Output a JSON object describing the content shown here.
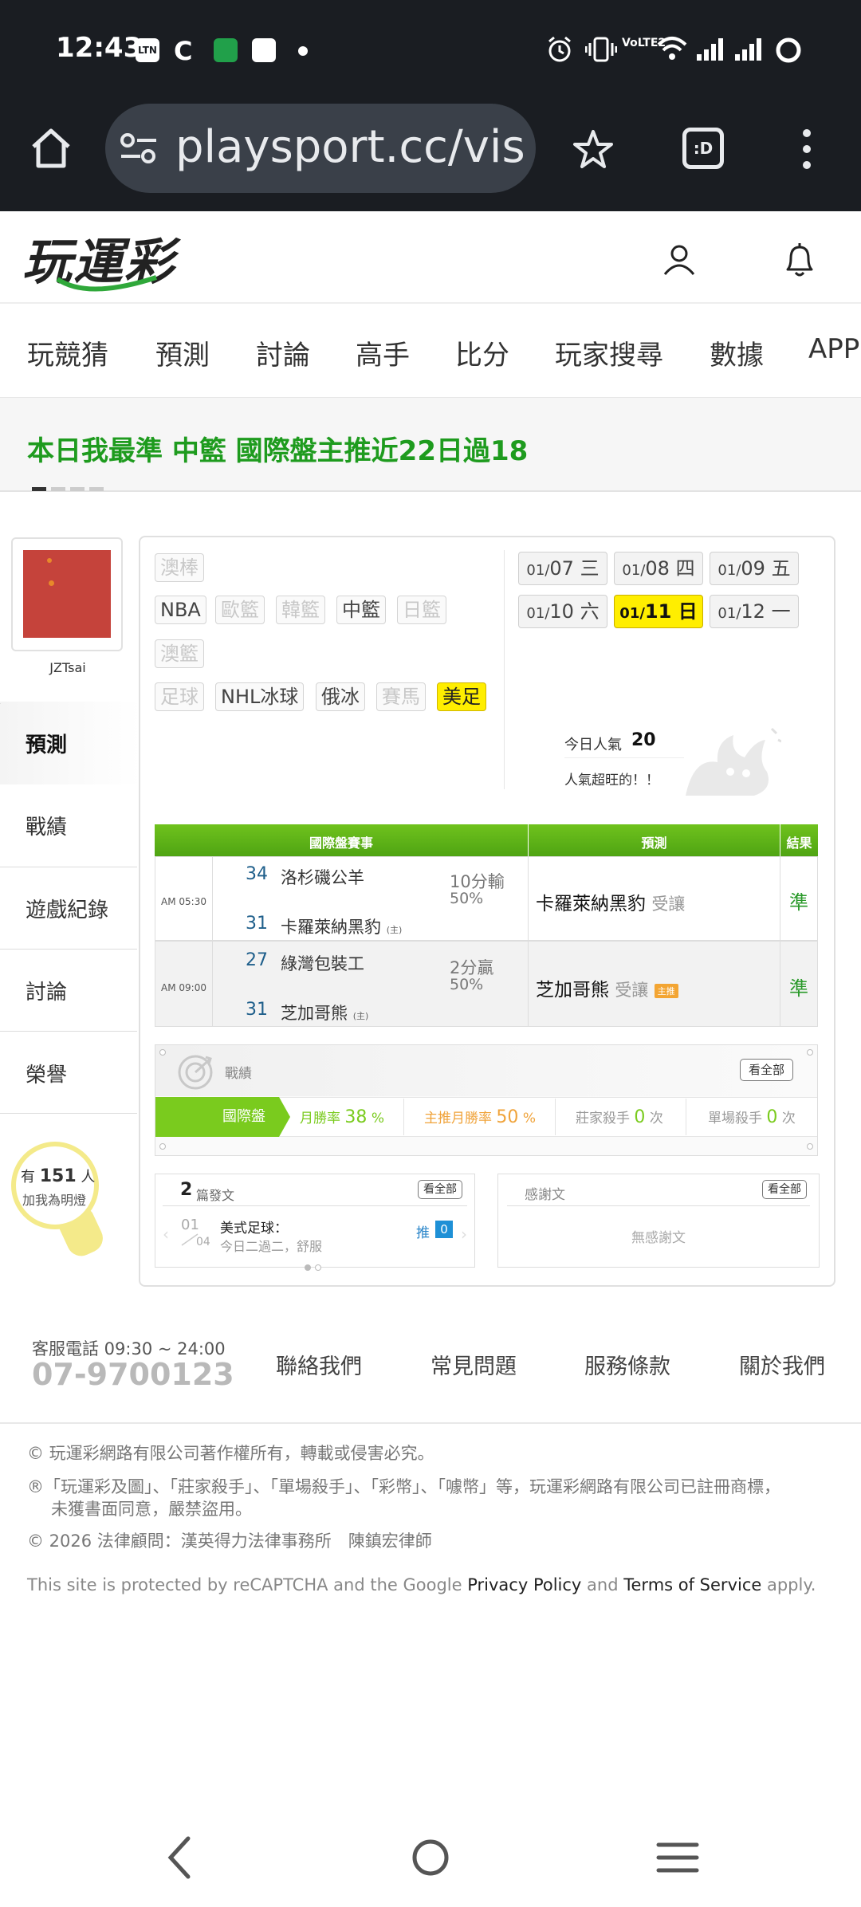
{
  "status_bar": {
    "time": "12:43",
    "icons": [
      "ltn-news-icon",
      "c-app-icon",
      "wallet-icon",
      "shopping-bag-icon",
      "dot-icon",
      "alarm-icon",
      "vibrate-icon",
      "volte-icon",
      "wifi-icon",
      "signal-icon",
      "signal-icon",
      "battery-icon"
    ],
    "ltn_label": "LTN",
    "c_label": "C",
    "volte_label": "VoLTE2"
  },
  "browser": {
    "url": "playsport.cc/visit",
    "tab_label": ":D"
  },
  "site": {
    "logo_text": "玩運彩"
  },
  "nav": {
    "items": [
      "玩競猜",
      "預測",
      "討論",
      "高手",
      "比分",
      "玩家搜尋",
      "數據",
      "APP"
    ]
  },
  "banner": {
    "text": "本日我最準 中籃 國際盤主推近22日過18"
  },
  "profile": {
    "username": "JZTsai",
    "menu": [
      "預測",
      "戰績",
      "遊戲紀錄",
      "討論",
      "榮譽"
    ],
    "bulb_prefix": "有",
    "bulb_count": "151",
    "bulb_suffix": "人",
    "bulb_text2": "加我為明燈"
  },
  "sports": {
    "row1": [
      "澳棒"
    ],
    "row2": [
      "NBA",
      "歐籃",
      "韓籃",
      "中籃",
      "日籃"
    ],
    "row3": [
      "澳籃"
    ],
    "row4": [
      "足球",
      "NHL冰球",
      "俄冰",
      "賽馬",
      "美足"
    ],
    "selected": "美足"
  },
  "dates": [
    {
      "md": "01/",
      "d": "07",
      "w": "三"
    },
    {
      "md": "01/",
      "d": "08",
      "w": "四"
    },
    {
      "md": "01/",
      "d": "09",
      "w": "五"
    },
    {
      "md": "01/",
      "d": "10",
      "w": "六"
    },
    {
      "md": "01/",
      "d": "11",
      "w": "日"
    },
    {
      "md": "01/",
      "d": "12",
      "w": "一"
    }
  ],
  "popularity": {
    "label": "今日人氣",
    "value": "20",
    "note": "人氣超旺的！！"
  },
  "table": {
    "headers": [
      "國際盤賽事",
      "預測",
      "結果"
    ],
    "rows": [
      {
        "time": "AM 05:30",
        "away_score": "34",
        "away_team": "洛杉磯公羊",
        "home_score": "31",
        "home_team": "卡羅萊納黑豹",
        "home_mark": "(主)",
        "odds": "10分輸",
        "pct": "50%",
        "pick": "卡羅萊納黑豹",
        "pick_sub": "受讓",
        "pick_badge": "",
        "result": "準"
      },
      {
        "time": "AM 09:00",
        "away_score": "27",
        "away_team": "綠灣包裝工",
        "home_score": "31",
        "home_team": "芝加哥熊",
        "home_mark": "(主)",
        "odds": "2分贏",
        "pct": "50%",
        "pick": "芝加哥熊",
        "pick_sub": "受讓",
        "pick_badge": "主推",
        "result": "準"
      }
    ]
  },
  "record": {
    "title": "戰績",
    "view_all": "看全部",
    "tab": "國際盤",
    "stats": [
      {
        "label": "月勝率",
        "value": "38",
        "unit": "%"
      },
      {
        "label": "主推月勝率",
        "value": "50",
        "unit": "%"
      },
      {
        "label": "莊家殺手",
        "value": "0",
        "unit": "次"
      },
      {
        "label": "單場殺手",
        "value": "0",
        "unit": "次"
      }
    ]
  },
  "posts": {
    "count": "2",
    "unit": "篇發文",
    "view_all": "看全部",
    "date_m": "01",
    "date_d": "04",
    "title": "美式足球：",
    "subtitle": "今日二過二，舒服",
    "push_label": "推",
    "push_count": "0"
  },
  "thanks": {
    "title": "感謝文",
    "view_all": "看全部",
    "empty": "無感謝文"
  },
  "footer": {
    "hours": "客服電話 09:30 ~ 24:00",
    "phone": "07-9700123",
    "links": [
      "聯絡我們",
      "常見問題",
      "服務條款",
      "關於我們"
    ],
    "legal1": "© 玩運彩網路有限公司著作權所有，轉載或侵害必究。",
    "legal2": "®「玩運彩及圖」、「莊家殺手」、「單場殺手」、「彩幣」、「噱幣」等，玩運彩網路有限公司已註冊商標，",
    "legal2b": "未獲書面同意，嚴禁盜用。",
    "legal3": "© 2026 法律顧問：漢英得力法律事務所　陳鎮宏律師",
    "recaptcha_pre": "This site is protected by reCAPTCHA and the Google",
    "privacy": "Privacy Policy",
    "and": "and",
    "terms": "Terms of Service",
    "apply": "apply."
  },
  "colors": {
    "accent_green": "#4fa413",
    "banner_green": "#1e9b1e",
    "highlight_yellow": "#ffee00"
  }
}
